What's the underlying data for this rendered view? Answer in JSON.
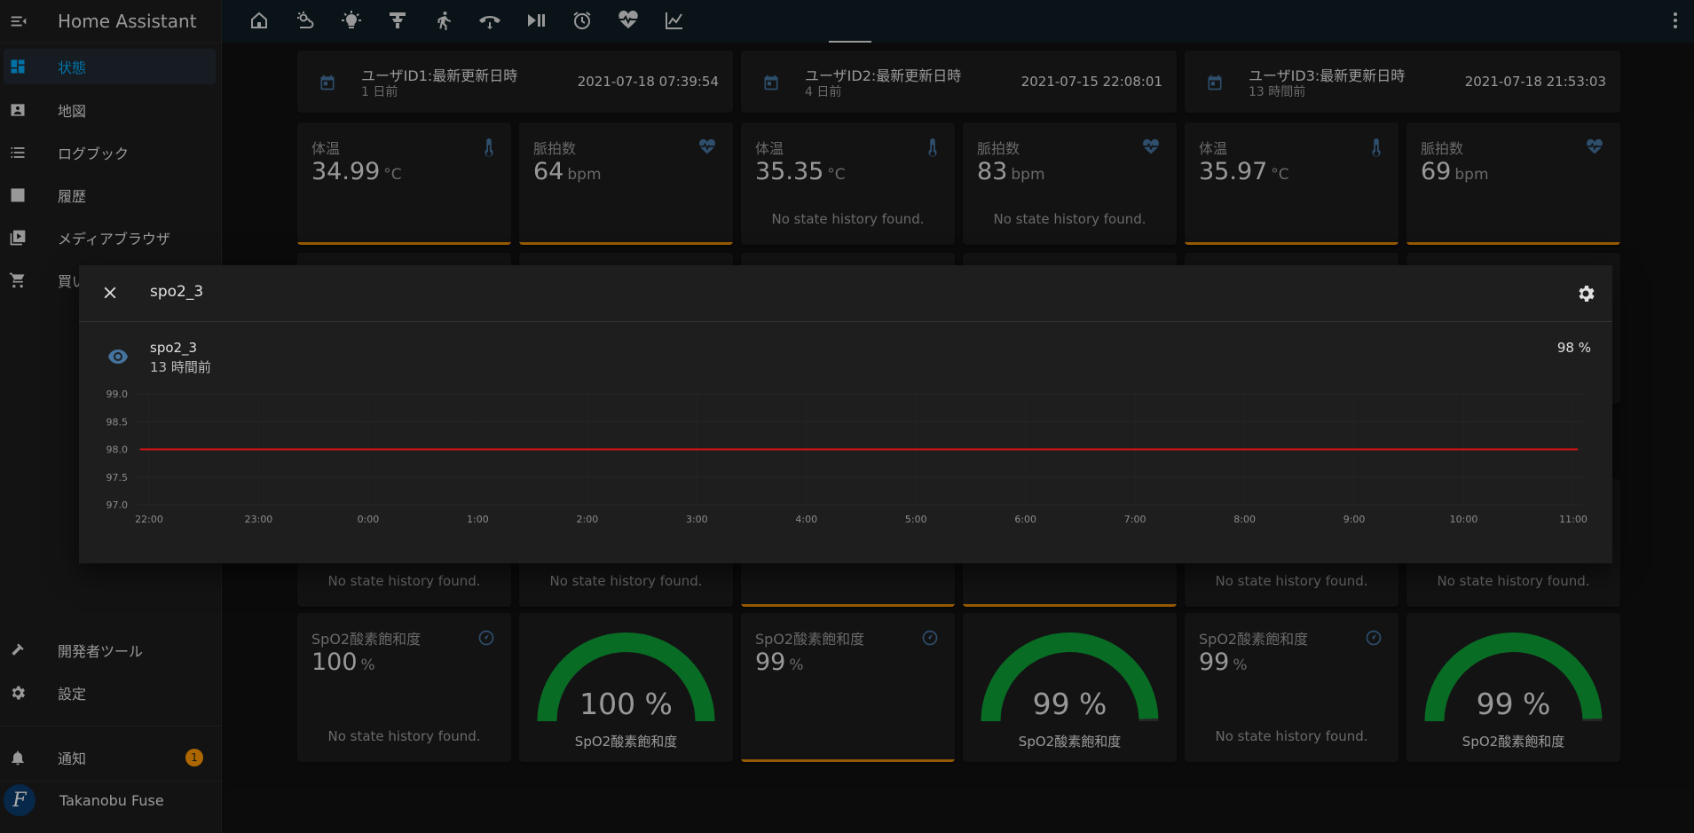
{
  "app": {
    "title": "Home Assistant"
  },
  "sidebar": {
    "items": [
      {
        "label": "状態",
        "icon": "dashboard-icon",
        "active": true
      },
      {
        "label": "地図",
        "icon": "map-icon"
      },
      {
        "label": "ログブック",
        "icon": "logbook-icon"
      },
      {
        "label": "履歴",
        "icon": "history-icon"
      },
      {
        "label": "メディアブラウザ",
        "icon": "media-browser-icon"
      },
      {
        "label": "買い",
        "icon": "cart-icon"
      }
    ],
    "dev_tools": "開発者ツール",
    "settings": "設定",
    "notifications": "通知",
    "notification_count": "1",
    "user_name": "Takanobu Fuse",
    "user_initial": "F"
  },
  "topbar": {
    "tabs": [
      "home-icon",
      "weather-icon",
      "lightbulb-icon",
      "ceiling-light-icon",
      "walk-icon",
      "phone-hangup-icon",
      "play-pause-icon",
      "alarm-icon",
      "heart-pulse-icon",
      "chart-line-icon"
    ],
    "active_tab": "heart-pulse-icon"
  },
  "users": [
    {
      "entity_title": "ユーザID1:最新更新日時",
      "entity_sub": "1 日前",
      "entity_date": "2021-07-18 07:39:54",
      "temp_label": "体温",
      "temp_value": "34.99",
      "temp_unit": "°C",
      "pulse_label": "脈拍数",
      "pulse_value": "64",
      "pulse_unit": "bpm",
      "spo2_label": "SpO2酸素飽和度",
      "spo2_value": "100",
      "spo2_unit": "%",
      "gauge_text": "100 %",
      "gauge_value": 100,
      "gauge_label": "SpO2酸素飽和度"
    },
    {
      "entity_title": "ユーザID2:最新更新日時",
      "entity_sub": "4 日前",
      "entity_date": "2021-07-15 22:08:01",
      "temp_label": "体温",
      "temp_value": "35.35",
      "temp_unit": "°C",
      "pulse_label": "脈拍数",
      "pulse_value": "83",
      "pulse_unit": "bpm",
      "spo2_label": "SpO2酸素飽和度",
      "spo2_value": "99",
      "spo2_unit": "%",
      "gauge_text": "99 %",
      "gauge_value": 99,
      "gauge_label": "SpO2酸素飽和度"
    },
    {
      "entity_title": "ユーザID3:最新更新日時",
      "entity_sub": "13 時間前",
      "entity_date": "2021-07-18 21:53:03",
      "temp_label": "体温",
      "temp_value": "35.97",
      "temp_unit": "°C",
      "pulse_label": "脈拍数",
      "pulse_value": "69",
      "pulse_unit": "bpm",
      "spo2_label": "SpO2酸素飽和度",
      "spo2_value": "99",
      "spo2_unit": "%",
      "gauge_text": "99 %",
      "gauge_value": 99,
      "gauge_label": "SpO2酸素飽和度"
    }
  ],
  "no_history": "No state history found.",
  "dialog": {
    "title": "spo2_3",
    "entity_name": "spo2_3",
    "last_changed": "13 時間前",
    "state": "98 %"
  },
  "colors": {
    "accent": "#03a9f4",
    "gauge": "#0da035",
    "line": "#e01212",
    "bar": "#ff9800"
  },
  "chart_data": {
    "type": "line",
    "x_ticks": [
      "22:00",
      "23:00",
      "0:00",
      "1:00",
      "2:00",
      "3:00",
      "4:00",
      "5:00",
      "6:00",
      "7:00",
      "8:00",
      "9:00",
      "10:00",
      "11:00"
    ],
    "y_ticks": [
      "99.0",
      "98.5",
      "98.0",
      "97.5",
      "97.0"
    ],
    "ylim": [
      97.0,
      99.0
    ],
    "series": [
      {
        "values": [
          98,
          98
        ]
      }
    ]
  }
}
